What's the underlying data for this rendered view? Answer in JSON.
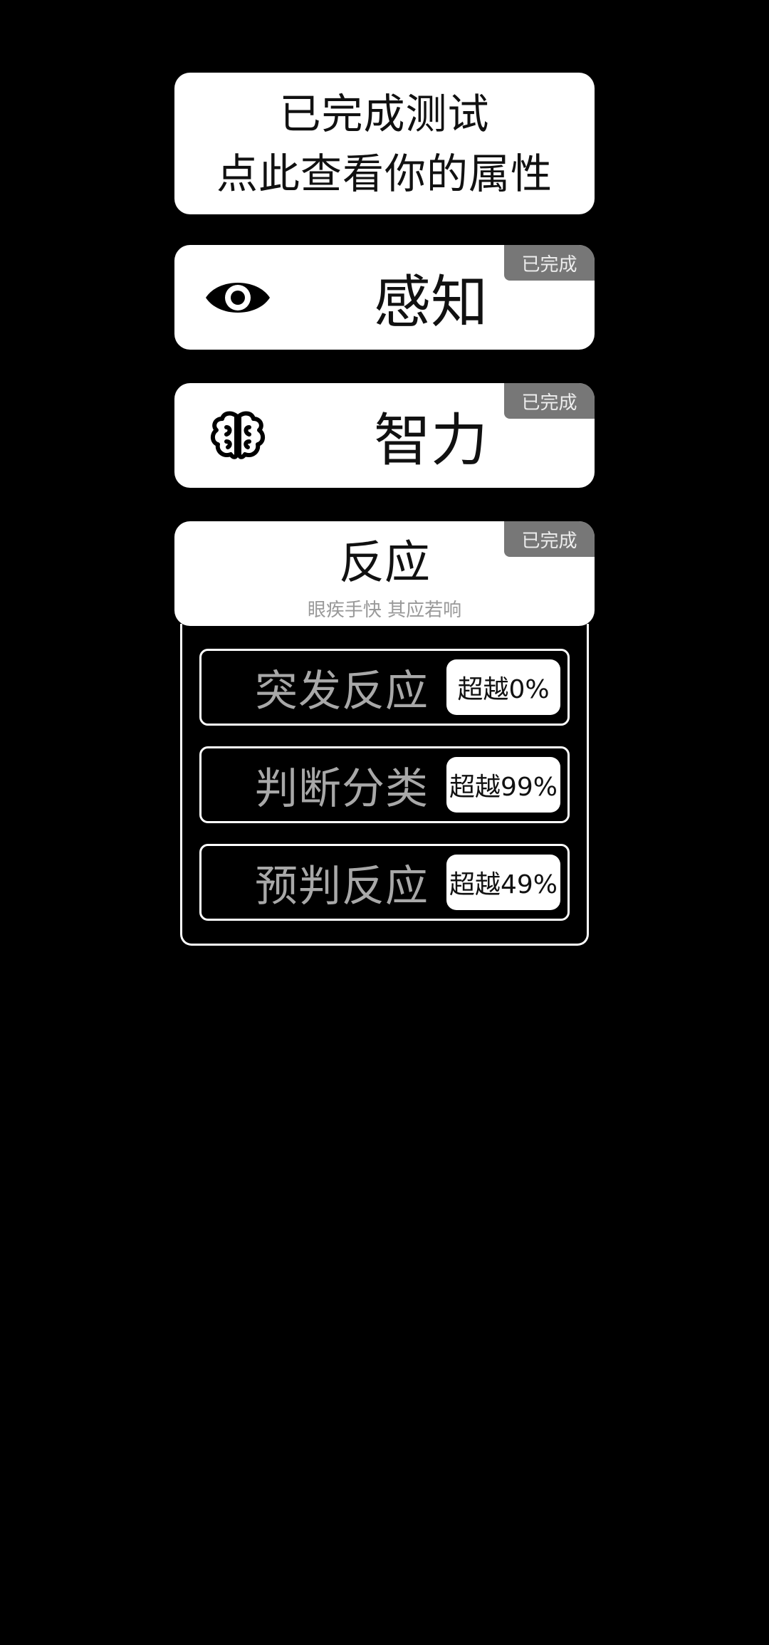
{
  "summary": {
    "line1": "已完成测试",
    "line2": "点此查看你的属性"
  },
  "categories": [
    {
      "title": "感知",
      "icon": "eye-icon",
      "badge": "已完成"
    },
    {
      "title": "智力",
      "icon": "brain-icon",
      "badge": "已完成"
    },
    {
      "title": "反应",
      "subtitle": "眼疾手快 其应若响",
      "badge": "已完成",
      "tests": [
        {
          "label": "突发反应",
          "score": "超越0%"
        },
        {
          "label": "判断分类",
          "score": "超越99%"
        },
        {
          "label": "预判反应",
          "score": "超越49%"
        }
      ]
    }
  ]
}
